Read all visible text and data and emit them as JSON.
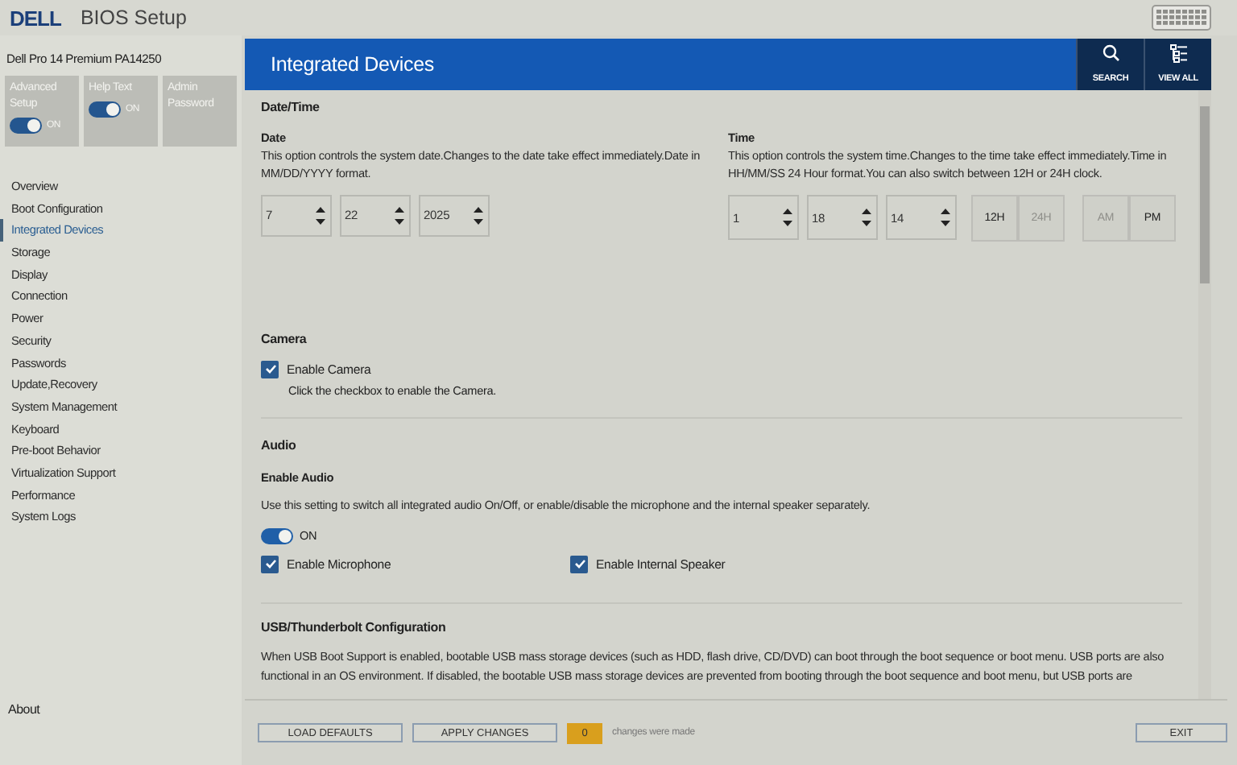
{
  "header": {
    "logo": "DELL",
    "title": "BIOS Setup"
  },
  "model": "Dell Pro 14 Premium PA14250",
  "quick_settings": [
    {
      "label": "Advanced Setup",
      "kind": "toggle",
      "on": true,
      "state_label": "ON"
    },
    {
      "label": "Help Text",
      "kind": "toggle",
      "on": true,
      "state_label": "ON"
    },
    {
      "label": "Admin Password",
      "kind": "link"
    }
  ],
  "nav": [
    {
      "label": "Overview",
      "selected": false
    },
    {
      "label": "Boot Configuration",
      "selected": false
    },
    {
      "label": "Integrated Devices",
      "selected": true
    },
    {
      "label": "Storage",
      "selected": false
    },
    {
      "label": "Display",
      "selected": false
    },
    {
      "label": "Connection",
      "selected": false
    },
    {
      "label": "Power",
      "selected": false
    },
    {
      "label": "Security",
      "selected": false
    },
    {
      "label": "Passwords",
      "selected": false
    },
    {
      "label": "Update,Recovery",
      "selected": false
    },
    {
      "label": "System Management",
      "selected": false
    },
    {
      "label": "Keyboard",
      "selected": false
    },
    {
      "label": "Pre-boot Behavior",
      "selected": false
    },
    {
      "label": "Virtualization Support",
      "selected": false
    },
    {
      "label": "Performance",
      "selected": false
    },
    {
      "label": "System Logs",
      "selected": false
    }
  ],
  "about": "About",
  "page": {
    "title": "Integrated Devices",
    "actions": [
      {
        "label": "SEARCH",
        "kind": "search"
      },
      {
        "label": "VIEW ALL",
        "kind": "list"
      }
    ]
  },
  "date_time": {
    "title": "Date/Time",
    "date": {
      "label": "Date",
      "description": "This option controls the system date.Changes to the date take effect immediately.Date in MM/DD/YYYY format.",
      "fields": [
        "7",
        "22",
        "2025"
      ]
    },
    "time": {
      "label": "Time",
      "description": "This option controls the system time.Changes to the time take effect immediately.Time in HH/MM/SS 24 Hour format.You can also switch between 12H or 24H clock.",
      "fields": [
        "1",
        "18",
        "14"
      ],
      "clock_modes": [
        {
          "label": "12H",
          "selected": true
        },
        {
          "label": "24H",
          "selected": false
        }
      ],
      "meridiem": [
        {
          "label": "AM",
          "selected": false
        },
        {
          "label": "PM",
          "selected": true
        }
      ]
    }
  },
  "camera": {
    "title": "Camera",
    "option": {
      "label": "Enable Camera",
      "checked": true,
      "description": "Click the checkbox to enable the Camera."
    }
  },
  "audio": {
    "title": "Audio",
    "subtitle": "Enable Audio",
    "description": "Use this setting to switch all integrated audio On/Off, or enable/disable the microphone and the internal speaker separately.",
    "toggle": {
      "on": true,
      "state_label": "ON"
    },
    "options": [
      {
        "label": "Enable Microphone",
        "checked": true
      },
      {
        "label": "Enable Internal Speaker",
        "checked": true
      }
    ]
  },
  "usb": {
    "title": "USB/Thunderbolt Configuration",
    "description": "When USB Boot Support is enabled, bootable USB mass storage devices (such as HDD, flash drive, CD/DVD) can boot through the boot sequence or boot menu. USB ports are also functional in an OS environment. If disabled, the bootable USB mass storage devices are prevented from booting through the boot sequence and boot menu, but USB ports are"
  },
  "footer": {
    "buttons": [
      "LOAD DEFAULTS",
      "APPLY CHANGES"
    ],
    "changes_count": "0",
    "changes_text": "changes were made",
    "exit": "EXIT"
  }
}
